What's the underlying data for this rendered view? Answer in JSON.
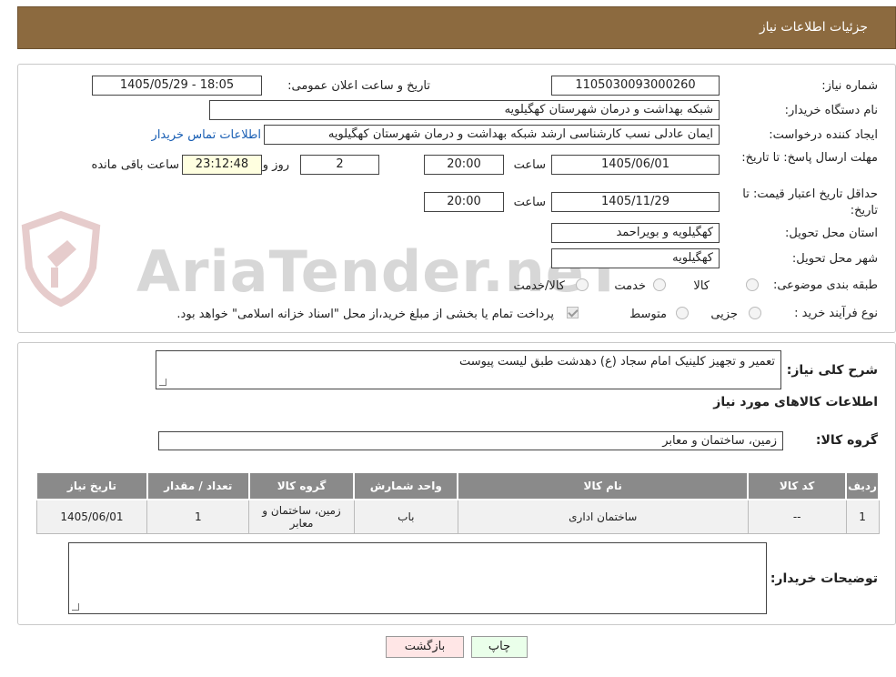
{
  "header": {
    "title": "جزئیات اطلاعات نیاز"
  },
  "watermark": {
    "text": "AriaTender.neT"
  },
  "form": {
    "need_number_label": "شماره نیاز:",
    "need_number": "1105030093000260",
    "announce_label": "تاریخ و ساعت اعلان عمومی:",
    "announce_value": "1405/05/29 - 18:05",
    "buyer_org_label": "نام دستگاه خریدار:",
    "buyer_org": "شبکه بهداشت و درمان شهرستان کهگیلویه",
    "creator_label": "ایجاد کننده درخواست:",
    "creator": "ایمان عادلی نسب کارشناسی ارشد شبکه بهداشت و درمان شهرستان کهگیلویه",
    "contact_link": "اطلاعات تماس خریدار",
    "deadline_label": "مهلت ارسال پاسخ: تا تاریخ:",
    "deadline_date": "1405/06/01",
    "time_label": "ساعت",
    "deadline_time": "20:00",
    "days_value": "2",
    "days_label": "روز و",
    "remaining_time": "23:12:48",
    "remaining_label": "ساعت باقی مانده",
    "validity_label": "حداقل تاریخ اعتبار قیمت: تا تاریخ:",
    "validity_date": "1405/11/29",
    "validity_time": "20:00",
    "province_label": "استان محل تحویل:",
    "province": "کهگیلویه و بویراحمد",
    "city_label": "شهر محل تحویل:",
    "city": "کهگیلویه",
    "category_label": "طبقه بندی موضوعی:",
    "category_options": [
      "کالا",
      "خدمت",
      "کالا/خدمت"
    ],
    "process_label": "نوع فرآیند خرید :",
    "process_options": [
      "جزیی",
      "متوسط"
    ],
    "payment_note": "پرداخت تمام یا بخشی از مبلغ خرید،از محل \"اسناد خزانه اسلامی\" خواهد بود."
  },
  "summary": {
    "desc_label": "شرح کلی نیاز:",
    "desc_value": "تعمیر و تجهیز کلینیک امام سجاد (ع) دهدشت طبق لیست پیوست",
    "goods_title": "اطلاعات کالاهای مورد نیاز",
    "group_label": "گروه کالا:",
    "group_value": "زمین، ساختمان و معابر",
    "table": {
      "headers": [
        "ردیف",
        "کد کالا",
        "نام کالا",
        "واحد شمارش",
        "گروه کالا",
        "تعداد / مقدار",
        "تاریخ نیاز"
      ],
      "rows": [
        [
          "1",
          "--",
          "ساختمان اداری",
          "باب",
          "زمین، ساختمان و معابر",
          "1",
          "1405/06/01"
        ]
      ]
    },
    "buyer_notes_label": "توضیحات خریدار:",
    "buyer_notes_value": ""
  },
  "buttons": {
    "print": "چاپ",
    "back": "بازگشت"
  }
}
